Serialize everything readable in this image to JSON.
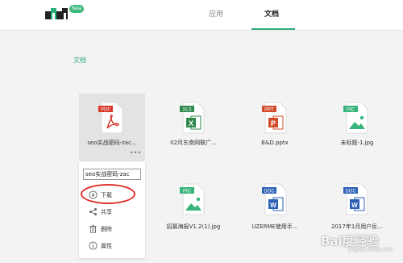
{
  "header": {
    "badge": "Beta",
    "tabs": [
      {
        "label": "应用",
        "active": false
      },
      {
        "label": "文档",
        "active": true
      }
    ]
  },
  "breadcrumb": "文档",
  "files": [
    {
      "name": "seo实战密码-zac...",
      "type": "PDF",
      "color": "#d9372a",
      "selected": true
    },
    {
      "name": "02月东南网联广...",
      "type": "XLS",
      "color": "#2e8a4d",
      "selected": false
    },
    {
      "name": "B&D.pptx",
      "type": "PPT",
      "color": "#d24a28",
      "selected": false
    },
    {
      "name": "未标题-1.jpg",
      "type": "PIC",
      "color": "#39b37c",
      "selected": false
    },
    {
      "name": "招募海报V1.2(1).jpg",
      "type": "PIC",
      "color": "#39b37c",
      "selected": false
    },
    {
      "name": "UZERME使用手...",
      "type": "DOC",
      "color": "#2c5fb6",
      "selected": false
    },
    {
      "name": "2017年1月用户反...",
      "type": "DOC",
      "color": "#2c5fb6",
      "selected": false
    }
  ],
  "context_menu": {
    "rename_value": "seo实战密码-zac",
    "items": [
      {
        "label": "下载",
        "icon": "download-icon"
      },
      {
        "label": "共享",
        "icon": "share-icon"
      },
      {
        "label": "删除",
        "icon": "trash-icon"
      },
      {
        "label": "属性",
        "icon": "info-icon"
      }
    ]
  },
  "watermark": {
    "text": "Bai度经验",
    "sub": "jingyan.baidu.com"
  },
  "colors": {
    "accent": "#2cb07a",
    "highlight": "#e0312c"
  }
}
